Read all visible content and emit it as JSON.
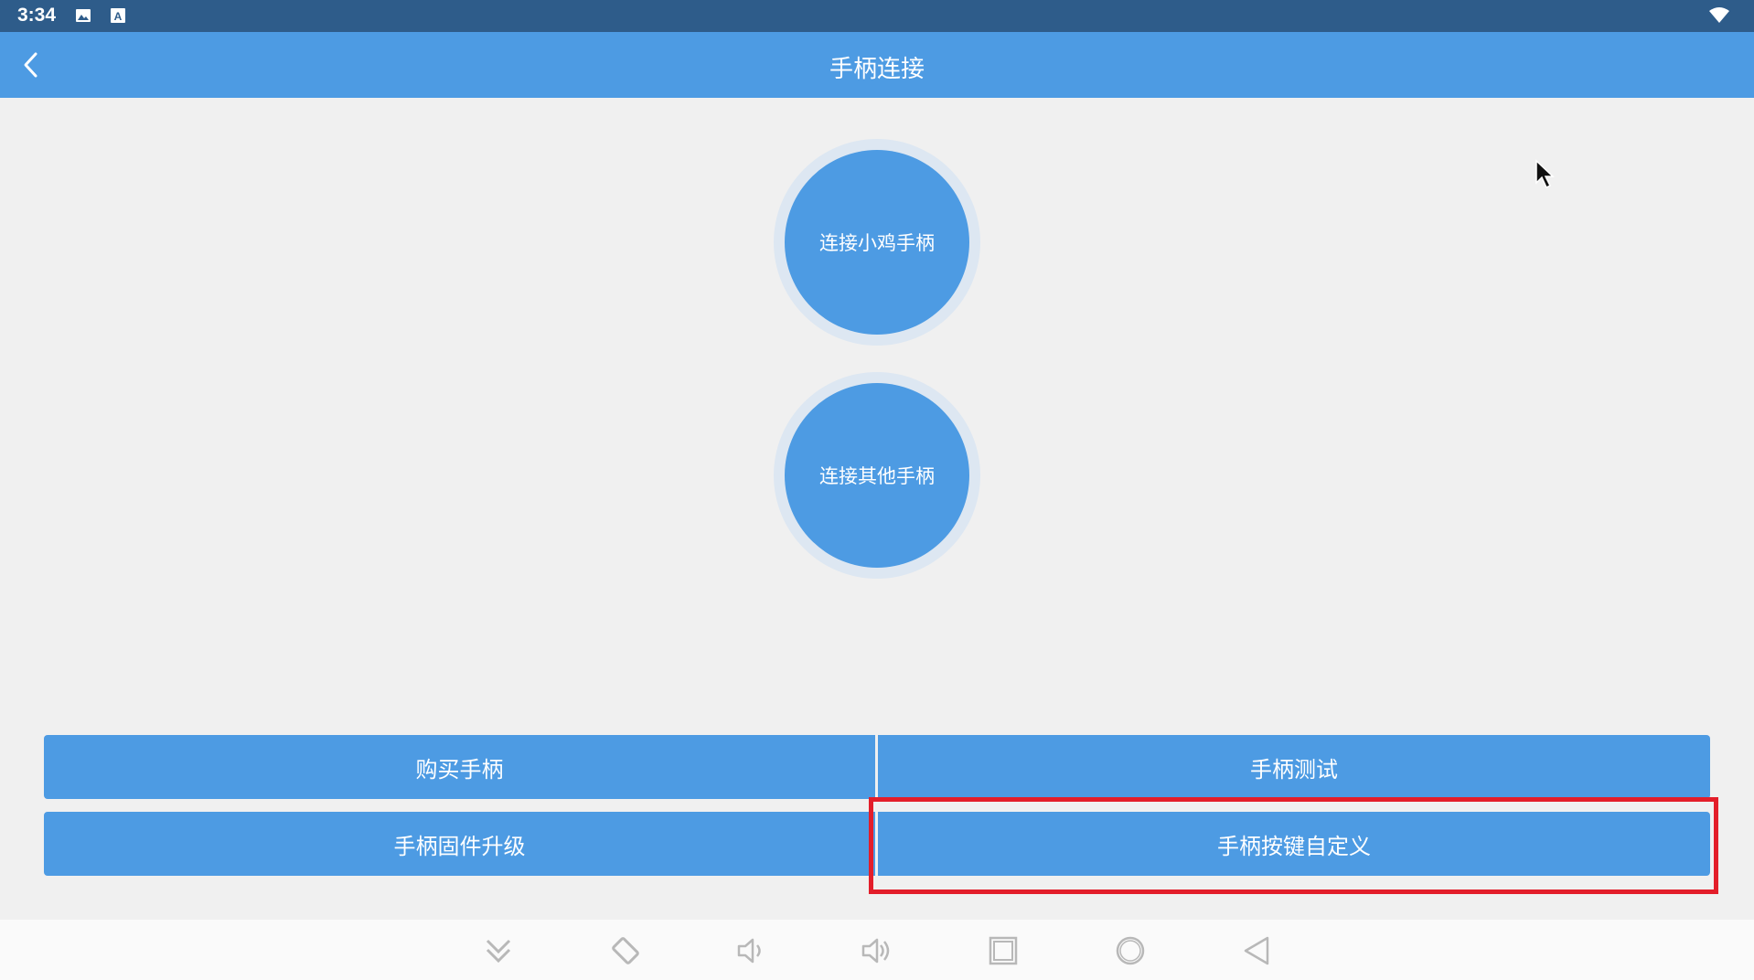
{
  "status_bar": {
    "time": "3:34",
    "icons": [
      "image-icon",
      "keyboard-a-icon",
      "wifi-icon"
    ]
  },
  "app_bar": {
    "title": "手柄连接",
    "back_icon": "chevron-left-icon"
  },
  "connect_buttons": [
    {
      "label": "连接小鸡手柄"
    },
    {
      "label": "连接其他手柄"
    }
  ],
  "menu": {
    "buy": "购买手柄",
    "test": "手柄测试",
    "firmware": "手柄固件升级",
    "customize": "手柄按键自定义"
  },
  "nav_bar": {
    "icons": [
      "double-chevron-down-icon",
      "rotate-icon",
      "volume-down-icon",
      "volume-up-icon",
      "square-recents-icon",
      "circle-home-icon",
      "triangle-back-icon"
    ]
  },
  "colors": {
    "primary": "#4d9be3",
    "status_bar": "#2e5c8a",
    "highlight": "#e31e2a",
    "background": "#f0f0f0"
  }
}
